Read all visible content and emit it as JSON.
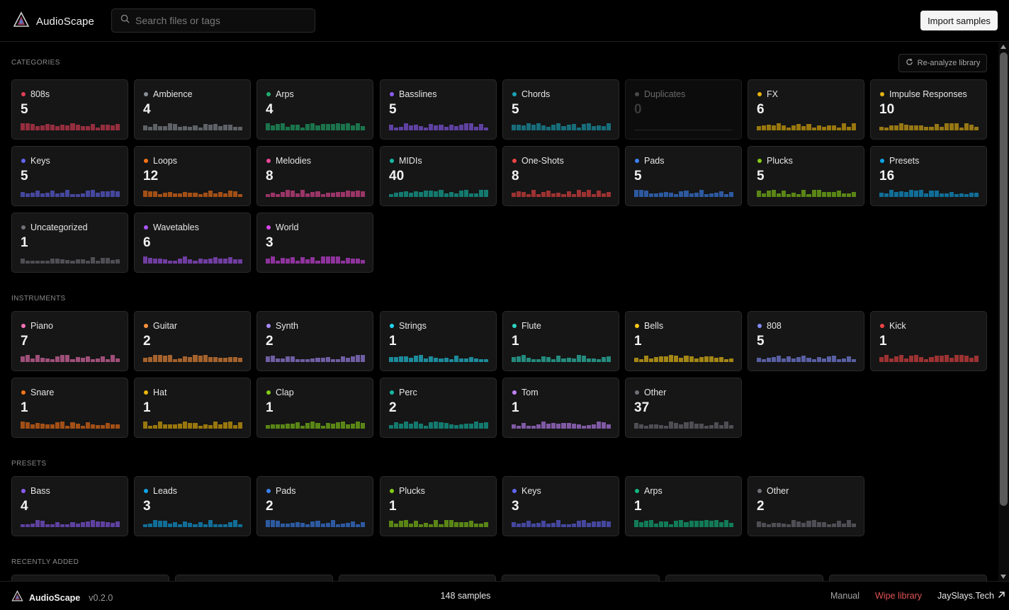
{
  "header": {
    "app_name": "AudioScape",
    "search_placeholder": "Search files or tags",
    "import_button": "Import samples"
  },
  "sections": {
    "categories": {
      "title": "CATEGORIES",
      "reanalyze_button": "Re-analyze library",
      "items": [
        {
          "label": "808s",
          "count": "5",
          "color": "#e23e57"
        },
        {
          "label": "Ambience",
          "count": "4",
          "color": "#8a8f98"
        },
        {
          "label": "Arps",
          "count": "4",
          "color": "#1fae6e"
        },
        {
          "label": "Basslines",
          "count": "5",
          "color": "#8b5cf6"
        },
        {
          "label": "Chords",
          "count": "5",
          "color": "#18a3b8"
        },
        {
          "label": "Duplicates",
          "count": "0",
          "color": "#4a4a4a",
          "disabled": true
        },
        {
          "label": "FX",
          "count": "6",
          "color": "#eab308"
        },
        {
          "label": "Impulse Responses",
          "count": "10",
          "color": "#e5b314"
        },
        {
          "label": "Keys",
          "count": "5",
          "color": "#6366f1"
        },
        {
          "label": "Loops",
          "count": "12",
          "color": "#f97316"
        },
        {
          "label": "Melodies",
          "count": "8",
          "color": "#ec4899"
        },
        {
          "label": "MIDIs",
          "count": "40",
          "color": "#14b8a6"
        },
        {
          "label": "One-Shots",
          "count": "8",
          "color": "#ef4444"
        },
        {
          "label": "Pads",
          "count": "5",
          "color": "#3b82f6"
        },
        {
          "label": "Plucks",
          "count": "5",
          "color": "#84cc16"
        },
        {
          "label": "Presets",
          "count": "16",
          "color": "#0ea5e9"
        },
        {
          "label": "Uncategorized",
          "count": "1",
          "color": "#71717a"
        },
        {
          "label": "Wavetables",
          "count": "6",
          "color": "#a855f7"
        },
        {
          "label": "World",
          "count": "3",
          "color": "#d946ef"
        }
      ]
    },
    "instruments": {
      "title": "INSTRUMENTS",
      "items": [
        {
          "label": "Piano",
          "count": "7",
          "color": "#f472b6"
        },
        {
          "label": "Guitar",
          "count": "2",
          "color": "#fb923c"
        },
        {
          "label": "Synth",
          "count": "2",
          "color": "#a78bfa"
        },
        {
          "label": "Strings",
          "count": "1",
          "color": "#22d3ee"
        },
        {
          "label": "Flute",
          "count": "1",
          "color": "#2dd4bf"
        },
        {
          "label": "Bells",
          "count": "1",
          "color": "#facc15"
        },
        {
          "label": "808",
          "count": "5",
          "color": "#818cf8"
        },
        {
          "label": "Kick",
          "count": "1",
          "color": "#ef4444"
        },
        {
          "label": "Snare",
          "count": "1",
          "color": "#f97316"
        },
        {
          "label": "Hat",
          "count": "1",
          "color": "#eab308"
        },
        {
          "label": "Clap",
          "count": "1",
          "color": "#84cc16"
        },
        {
          "label": "Perc",
          "count": "2",
          "color": "#14b8a6"
        },
        {
          "label": "Tom",
          "count": "1",
          "color": "#c084fc"
        },
        {
          "label": "Other",
          "count": "37",
          "color": "#71717a"
        }
      ]
    },
    "presets": {
      "title": "PRESETS",
      "items": [
        {
          "label": "Bass",
          "count": "4",
          "color": "#8b5cf6"
        },
        {
          "label": "Leads",
          "count": "3",
          "color": "#0ea5e9"
        },
        {
          "label": "Pads",
          "count": "2",
          "color": "#3b82f6"
        },
        {
          "label": "Plucks",
          "count": "1",
          "color": "#84cc16"
        },
        {
          "label": "Keys",
          "count": "3",
          "color": "#6366f1"
        },
        {
          "label": "Arps",
          "count": "1",
          "color": "#10b981"
        },
        {
          "label": "Other",
          "count": "2",
          "color": "#71717a"
        }
      ]
    },
    "recent": {
      "title": "RECENTLY ADDED"
    }
  },
  "footer": {
    "app_name": "AudioScape",
    "version": "v0.2.0",
    "sample_count": "148 samples",
    "manual": "Manual",
    "wipe": "Wipe library",
    "site": "JaySlays.Tech"
  }
}
